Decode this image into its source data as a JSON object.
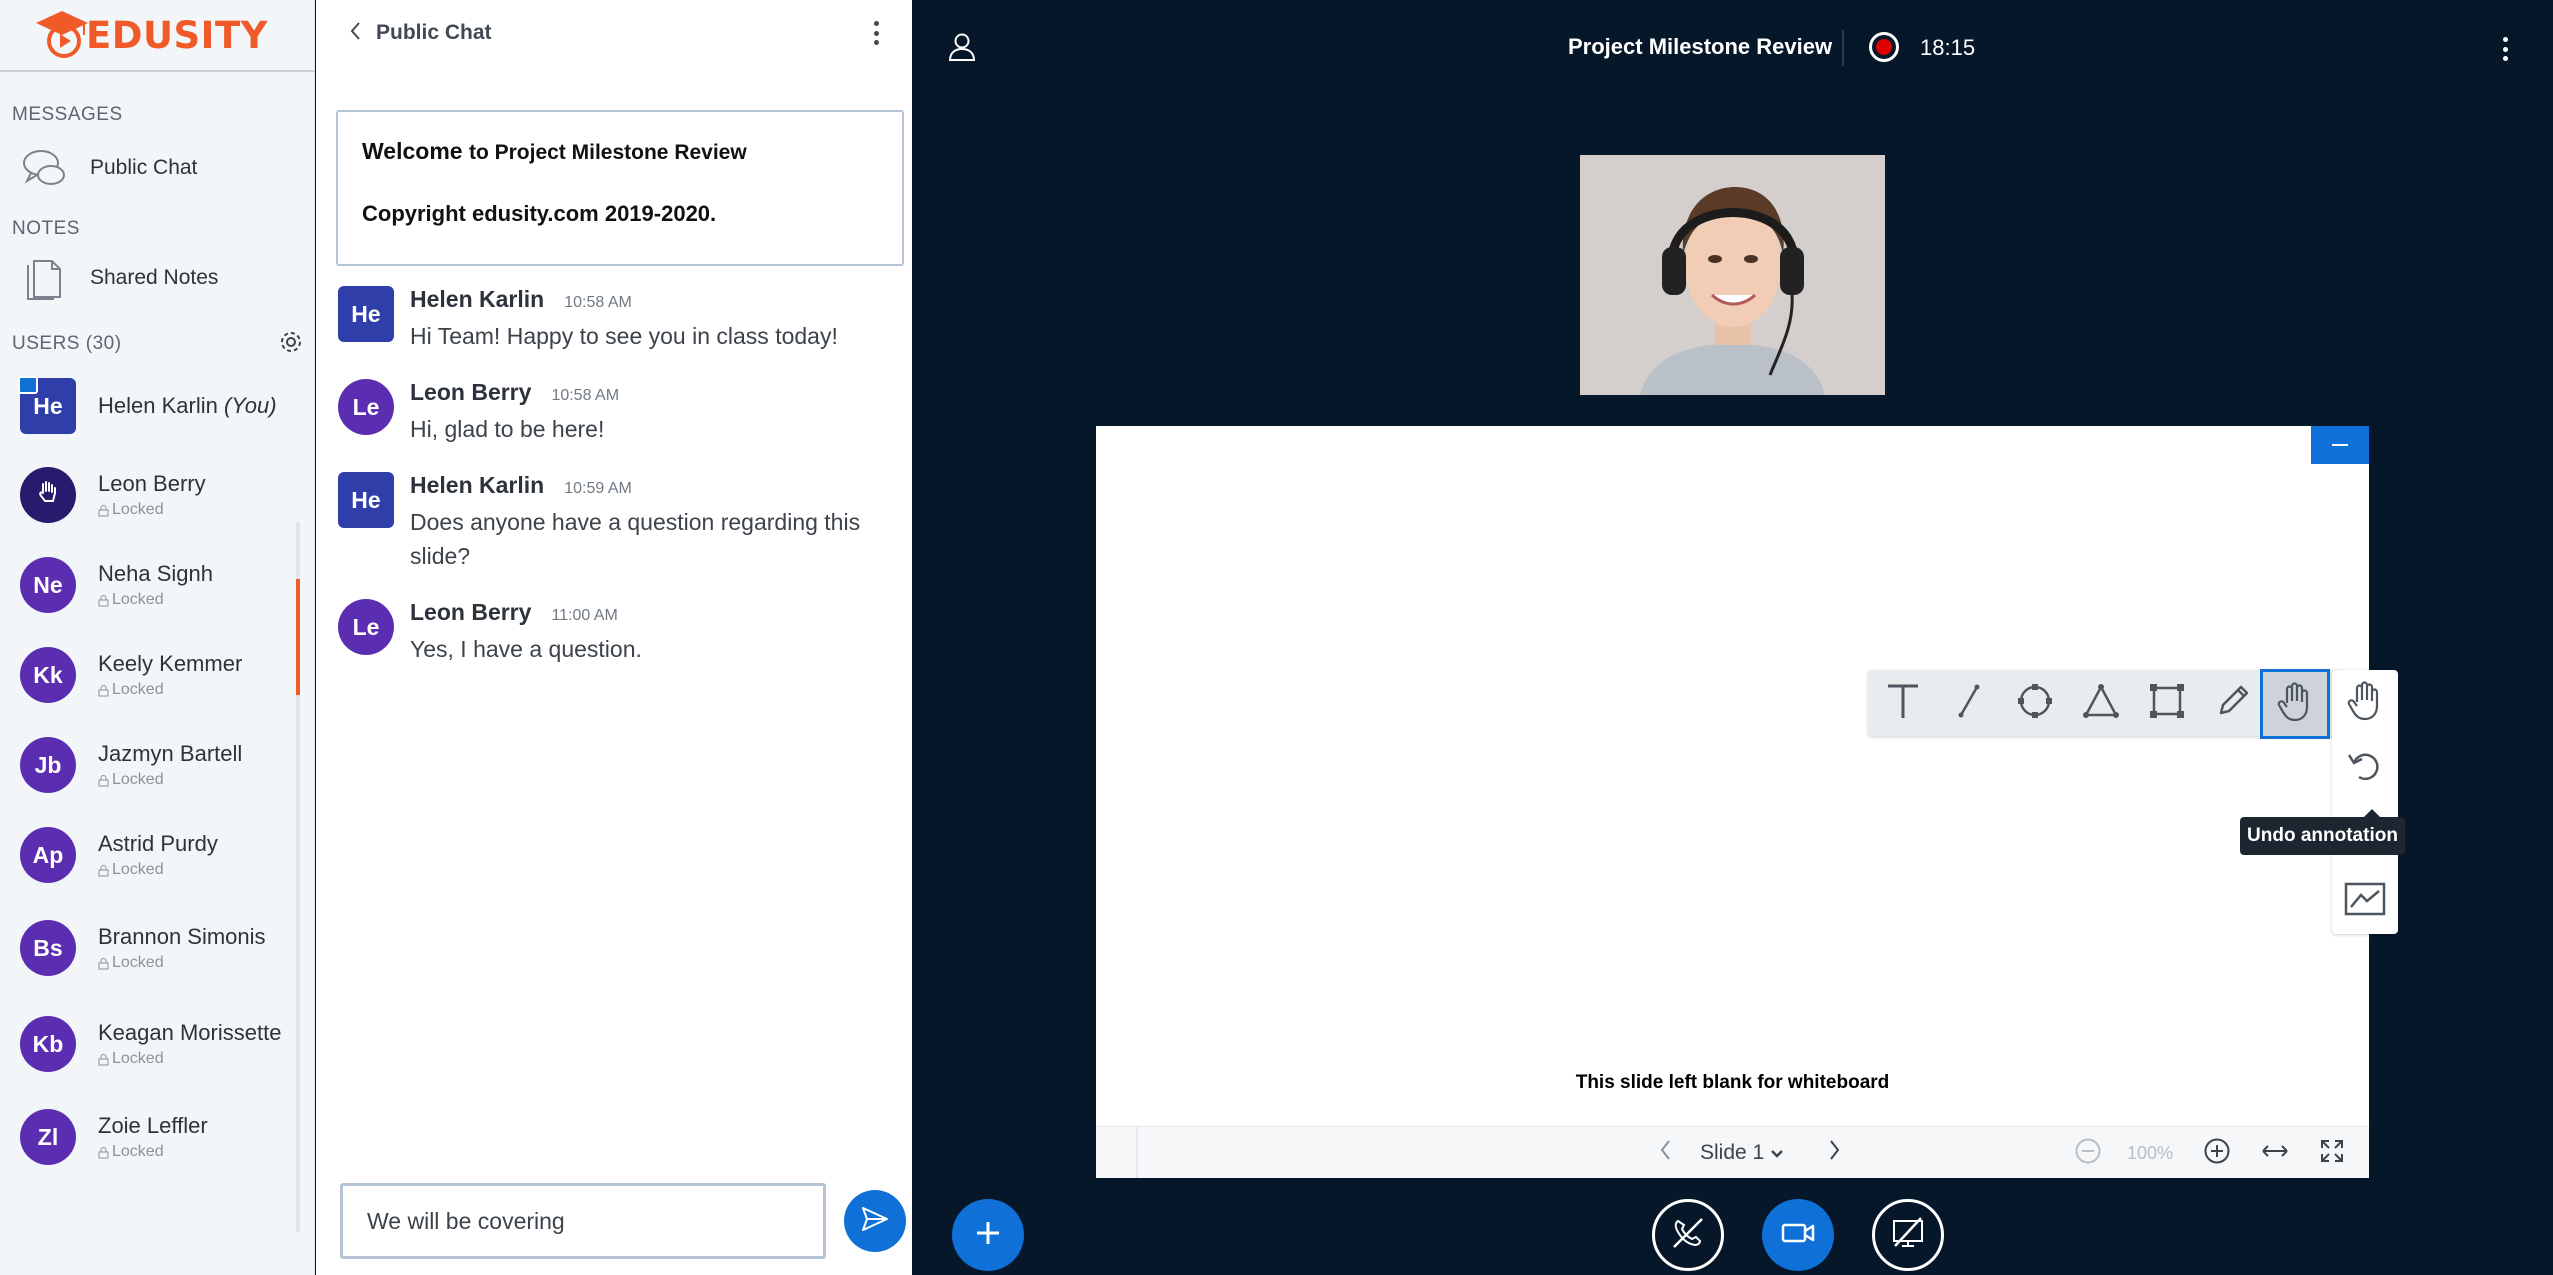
{
  "brand": {
    "name": "EDUSITY"
  },
  "sidebar": {
    "messages_title": "MESSAGES",
    "public_chat_label": "Public Chat",
    "notes_title": "NOTES",
    "shared_notes_label": "Shared Notes",
    "users_title": "USERS (30)",
    "users": [
      {
        "initials": "He",
        "name": "Helen Karlin",
        "suffix": "(You)",
        "status": ""
      },
      {
        "initials": "",
        "name": "Leon Berry",
        "suffix": "",
        "status": "Locked"
      },
      {
        "initials": "Ne",
        "name": "Neha Signh",
        "suffix": "",
        "status": "Locked"
      },
      {
        "initials": "Kk",
        "name": "Keely Kemmer",
        "suffix": "",
        "status": "Locked"
      },
      {
        "initials": "Jb",
        "name": "Jazmyn Bartell",
        "suffix": "",
        "status": "Locked"
      },
      {
        "initials": "Ap",
        "name": "Astrid Purdy",
        "suffix": "",
        "status": "Locked"
      },
      {
        "initials": "Bs",
        "name": "Brannon Simonis",
        "suffix": "",
        "status": "Locked"
      },
      {
        "initials": "Kb",
        "name": "Keagan Morissette",
        "suffix": "",
        "status": "Locked"
      },
      {
        "initials": "Zl",
        "name": "Zoie Leffler",
        "suffix": "",
        "status": "Locked"
      }
    ]
  },
  "chat": {
    "title": "Public Chat",
    "welcome_word": "Welcome",
    "welcome_rest": "to Project Milestone Review",
    "copyright": "Copyright edusity.com 2019-2020.",
    "messages": [
      {
        "initials": "He",
        "name": "Helen Karlin",
        "time": "10:58 AM",
        "text": "Hi Team! Happy to see you in class today!"
      },
      {
        "initials": "Le",
        "name": "Leon Berry",
        "time": "10:58 AM",
        "text": "Hi, glad to be here!"
      },
      {
        "initials": "He",
        "name": "Helen Karlin",
        "time": "10:59 AM",
        "text": "Does anyone have a question regarding this slide?"
      },
      {
        "initials": "Le",
        "name": "Leon Berry",
        "time": "11:00 AM",
        "text": "Yes, I have a question."
      }
    ],
    "input_value": "We will be covering"
  },
  "meeting": {
    "title": "Project Milestone Review",
    "recording_time": "18:15"
  },
  "presentation": {
    "caption": "This slide left blank for whiteboard",
    "slide_label": "Slide 1",
    "zoom": "100%"
  },
  "annotation": {
    "tooltip": "Undo annotation",
    "tools": [
      "text-tool",
      "line-tool",
      "ellipse-tool",
      "triangle-tool",
      "rectangle-tool",
      "pencil-tool",
      "hand-tool"
    ]
  },
  "colors": {
    "brand": "#f05a28",
    "accent": "#0f70d7",
    "stage": "#06172a",
    "avatar": "#5b2db0",
    "self_avatar": "#2f3ea8",
    "record": "#e00000"
  }
}
